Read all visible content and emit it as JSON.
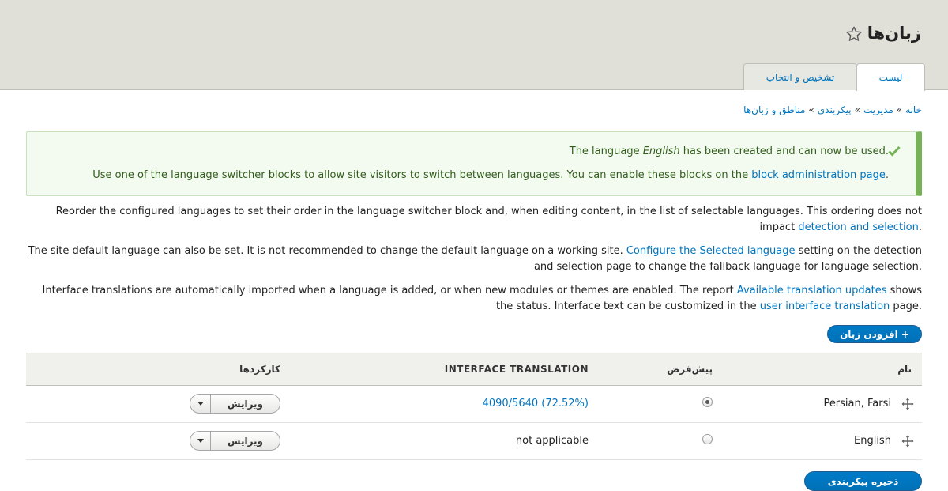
{
  "header": {
    "title": "زبان‌ها",
    "tabs": [
      {
        "label": "لیست",
        "active": true
      },
      {
        "label": "تشخیص و انتخاب",
        "active": false
      }
    ]
  },
  "breadcrumb": {
    "items": [
      "خانه",
      "مدیریت",
      "پیکربندی",
      "مناطق و زبان‌ها"
    ],
    "separator": "»"
  },
  "message": {
    "line1_before": "The language ",
    "line1_lang": "English",
    "line1_after": " has been created and can now be used.",
    "line2_text": "Use one of the language switcher blocks to allow site visitors to switch between languages. You can enable these blocks on the ",
    "line2_link": "block administration page",
    "line2_end": "."
  },
  "description": {
    "p1_line1": "Reorder the configured languages to set their order in the language switcher block and, when editing content, in the list of selectable languages. This ordering does not",
    "p1_line2_text": "impact ",
    "p1_line2_link": "detection and selection",
    "p1_line2_end": ".",
    "p2_line1_text": "The site default language can also be set. It is not recommended to change the default language on a working site. ",
    "p2_line1_link": "Configure the Selected language",
    "p2_line1_end": " setting on the detection",
    "p2_line2": "and selection page to change the fallback language for language selection.",
    "p3_line1_text": "Interface translations are automatically imported when a language is added, or when new modules or themes are enabled. The report ",
    "p3_line1_link": "Available translation updates",
    "p3_line1_end": " shows",
    "p3_line2_text": "the status. Interface text can be customized in the ",
    "p3_line2_link": "user interface translation",
    "p3_line2_end": " page."
  },
  "actions": {
    "add_language": "+ افزودن زبان",
    "save_configuration": "ذخیره پیکربندی"
  },
  "table": {
    "headers": {
      "name": "نام",
      "default": "پیش‌فرض",
      "translation": "INTERFACE TRANSLATION",
      "operations": "کارکردها"
    },
    "rows": [
      {
        "name": "Persian, Farsi",
        "default": true,
        "translation": "4090/5640 (72.52%)",
        "translation_is_link": true,
        "edit_label": "ویرایش"
      },
      {
        "name": "English",
        "default": false,
        "translation": "not applicable",
        "translation_is_link": false,
        "edit_label": "ویرایش"
      }
    ]
  },
  "colors": {
    "link": "#0074bd",
    "primary_button": "#0071b8",
    "status_message_bg": "#f3faef",
    "status_message_border": "#77b259"
  }
}
